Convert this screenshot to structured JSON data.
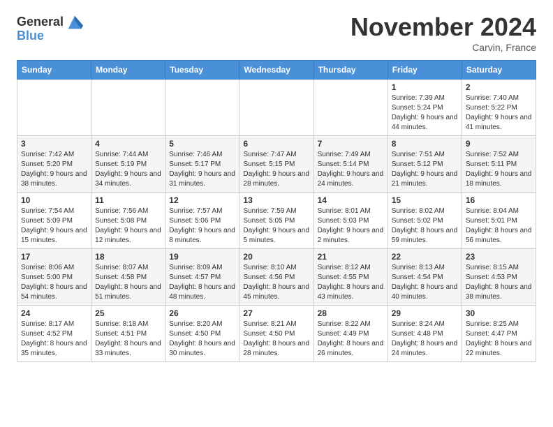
{
  "header": {
    "logo_line1": "General",
    "logo_line2": "Blue",
    "month_title": "November 2024",
    "location": "Carvin, France"
  },
  "days_of_week": [
    "Sunday",
    "Monday",
    "Tuesday",
    "Wednesday",
    "Thursday",
    "Friday",
    "Saturday"
  ],
  "weeks": [
    [
      {
        "day": "",
        "info": ""
      },
      {
        "day": "",
        "info": ""
      },
      {
        "day": "",
        "info": ""
      },
      {
        "day": "",
        "info": ""
      },
      {
        "day": "",
        "info": ""
      },
      {
        "day": "1",
        "info": "Sunrise: 7:39 AM\nSunset: 5:24 PM\nDaylight: 9 hours\nand 44 minutes."
      },
      {
        "day": "2",
        "info": "Sunrise: 7:40 AM\nSunset: 5:22 PM\nDaylight: 9 hours\nand 41 minutes."
      }
    ],
    [
      {
        "day": "3",
        "info": "Sunrise: 7:42 AM\nSunset: 5:20 PM\nDaylight: 9 hours\nand 38 minutes."
      },
      {
        "day": "4",
        "info": "Sunrise: 7:44 AM\nSunset: 5:19 PM\nDaylight: 9 hours\nand 34 minutes."
      },
      {
        "day": "5",
        "info": "Sunrise: 7:46 AM\nSunset: 5:17 PM\nDaylight: 9 hours\nand 31 minutes."
      },
      {
        "day": "6",
        "info": "Sunrise: 7:47 AM\nSunset: 5:15 PM\nDaylight: 9 hours\nand 28 minutes."
      },
      {
        "day": "7",
        "info": "Sunrise: 7:49 AM\nSunset: 5:14 PM\nDaylight: 9 hours\nand 24 minutes."
      },
      {
        "day": "8",
        "info": "Sunrise: 7:51 AM\nSunset: 5:12 PM\nDaylight: 9 hours\nand 21 minutes."
      },
      {
        "day": "9",
        "info": "Sunrise: 7:52 AM\nSunset: 5:11 PM\nDaylight: 9 hours\nand 18 minutes."
      }
    ],
    [
      {
        "day": "10",
        "info": "Sunrise: 7:54 AM\nSunset: 5:09 PM\nDaylight: 9 hours\nand 15 minutes."
      },
      {
        "day": "11",
        "info": "Sunrise: 7:56 AM\nSunset: 5:08 PM\nDaylight: 9 hours\nand 12 minutes."
      },
      {
        "day": "12",
        "info": "Sunrise: 7:57 AM\nSunset: 5:06 PM\nDaylight: 9 hours\nand 8 minutes."
      },
      {
        "day": "13",
        "info": "Sunrise: 7:59 AM\nSunset: 5:05 PM\nDaylight: 9 hours\nand 5 minutes."
      },
      {
        "day": "14",
        "info": "Sunrise: 8:01 AM\nSunset: 5:03 PM\nDaylight: 9 hours\nand 2 minutes."
      },
      {
        "day": "15",
        "info": "Sunrise: 8:02 AM\nSunset: 5:02 PM\nDaylight: 8 hours\nand 59 minutes."
      },
      {
        "day": "16",
        "info": "Sunrise: 8:04 AM\nSunset: 5:01 PM\nDaylight: 8 hours\nand 56 minutes."
      }
    ],
    [
      {
        "day": "17",
        "info": "Sunrise: 8:06 AM\nSunset: 5:00 PM\nDaylight: 8 hours\nand 54 minutes."
      },
      {
        "day": "18",
        "info": "Sunrise: 8:07 AM\nSunset: 4:58 PM\nDaylight: 8 hours\nand 51 minutes."
      },
      {
        "day": "19",
        "info": "Sunrise: 8:09 AM\nSunset: 4:57 PM\nDaylight: 8 hours\nand 48 minutes."
      },
      {
        "day": "20",
        "info": "Sunrise: 8:10 AM\nSunset: 4:56 PM\nDaylight: 8 hours\nand 45 minutes."
      },
      {
        "day": "21",
        "info": "Sunrise: 8:12 AM\nSunset: 4:55 PM\nDaylight: 8 hours\nand 43 minutes."
      },
      {
        "day": "22",
        "info": "Sunrise: 8:13 AM\nSunset: 4:54 PM\nDaylight: 8 hours\nand 40 minutes."
      },
      {
        "day": "23",
        "info": "Sunrise: 8:15 AM\nSunset: 4:53 PM\nDaylight: 8 hours\nand 38 minutes."
      }
    ],
    [
      {
        "day": "24",
        "info": "Sunrise: 8:17 AM\nSunset: 4:52 PM\nDaylight: 8 hours\nand 35 minutes."
      },
      {
        "day": "25",
        "info": "Sunrise: 8:18 AM\nSunset: 4:51 PM\nDaylight: 8 hours\nand 33 minutes."
      },
      {
        "day": "26",
        "info": "Sunrise: 8:20 AM\nSunset: 4:50 PM\nDaylight: 8 hours\nand 30 minutes."
      },
      {
        "day": "27",
        "info": "Sunrise: 8:21 AM\nSunset: 4:50 PM\nDaylight: 8 hours\nand 28 minutes."
      },
      {
        "day": "28",
        "info": "Sunrise: 8:22 AM\nSunset: 4:49 PM\nDaylight: 8 hours\nand 26 minutes."
      },
      {
        "day": "29",
        "info": "Sunrise: 8:24 AM\nSunset: 4:48 PM\nDaylight: 8 hours\nand 24 minutes."
      },
      {
        "day": "30",
        "info": "Sunrise: 8:25 AM\nSunset: 4:47 PM\nDaylight: 8 hours\nand 22 minutes."
      }
    ]
  ]
}
